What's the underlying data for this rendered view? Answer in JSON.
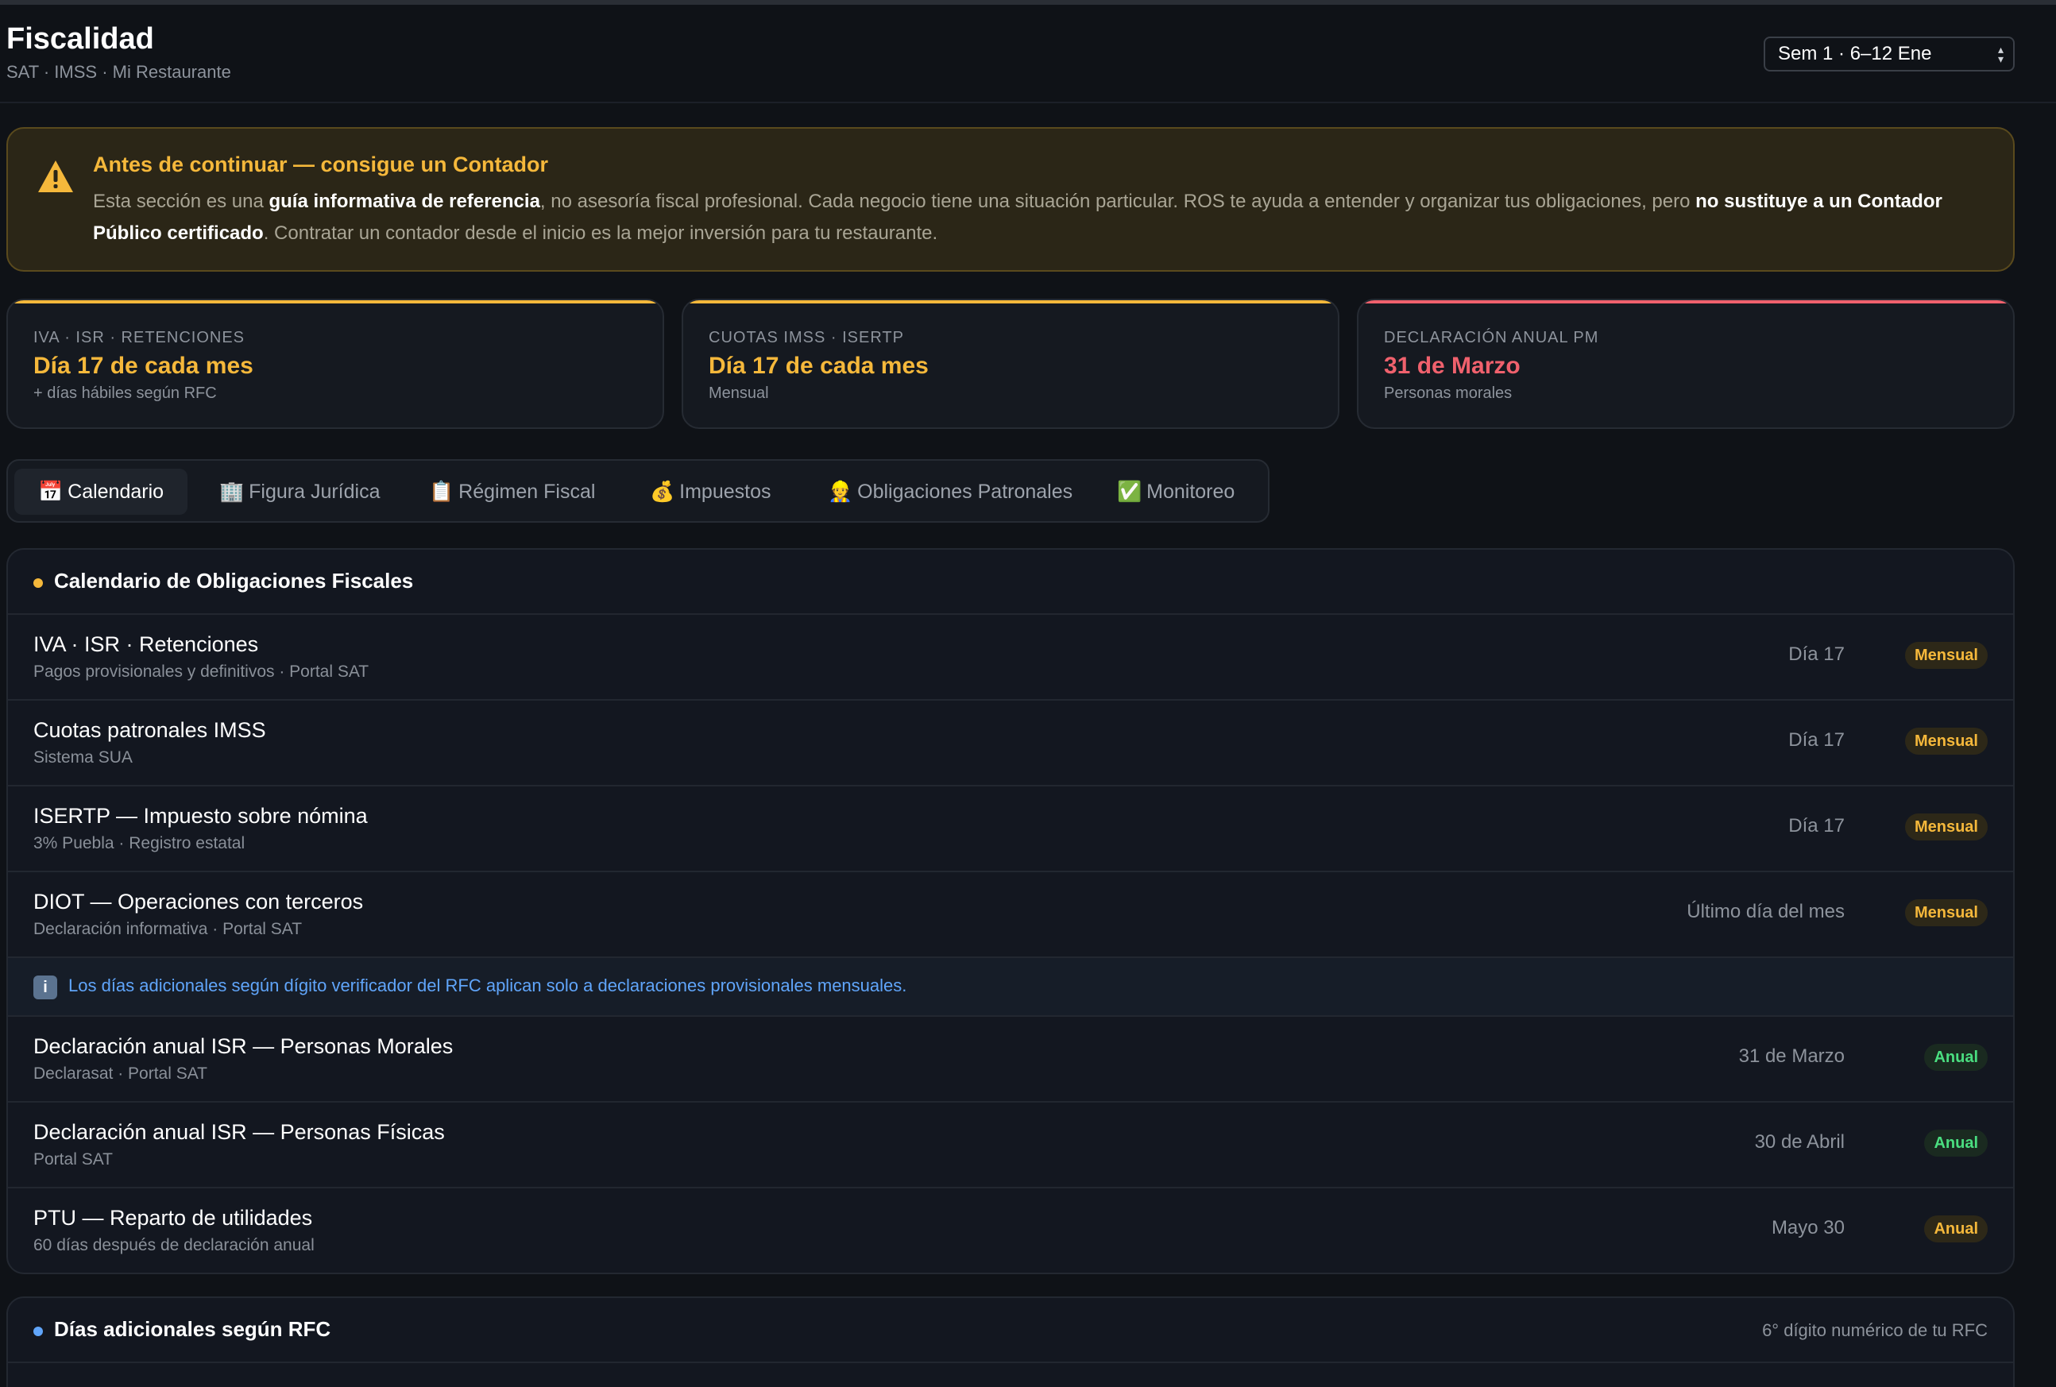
{
  "header": {
    "title": "Fiscalidad",
    "subtitle": "SAT · IMSS · Mi Restaurante",
    "week_selector": "Sem 1 · 6–12 Ene"
  },
  "warning": {
    "icon": "warning-triangle-icon",
    "title": "Antes de continuar — consigue un Contador",
    "text_1": "Esta sección es una ",
    "bold_1": "guía informativa de referencia",
    "text_2": ", no asesoría fiscal profesional. Cada negocio tiene una situación particular. ROS te ayuda a entender y organizar tus obligaciones, pero ",
    "bold_2": "no sustituye a un Contador Público certificado",
    "text_3": ". Contratar un contador desde el inicio es la mejor inversión para tu restaurante."
  },
  "cards": [
    {
      "label": "IVA · ISR · RETENCIONES",
      "value": "Día 17 de cada mes",
      "note": "+ días hábiles según RFC",
      "accent": "#f5b83b"
    },
    {
      "label": "CUOTAS IMSS · ISERTP",
      "value": "Día 17 de cada mes",
      "note": "Mensual",
      "accent": "#f5b83b"
    },
    {
      "label": "DECLARACIÓN ANUAL PM",
      "value": "31 de Marzo",
      "note": "Personas morales",
      "accent": "#f0616d"
    }
  ],
  "tabs": [
    {
      "icon": "📅",
      "label": "Calendario"
    },
    {
      "icon": "🏢",
      "label": "Figura Jurídica"
    },
    {
      "icon": "📋",
      "label": "Régimen Fiscal"
    },
    {
      "icon": "💰",
      "label": "Impuestos"
    },
    {
      "icon": "👷",
      "label": "Obligaciones Patronales"
    },
    {
      "icon": "✅",
      "label": "Monitoreo"
    }
  ],
  "calendar": {
    "title": "Calendario de Obligaciones Fiscales",
    "dot_color": "#f5b83b",
    "rows": [
      {
        "name": "IVA · ISR · Retenciones",
        "desc": "Pagos provisionales y definitivos · Portal SAT",
        "when": "Día 17",
        "badge": "Mensual"
      },
      {
        "name": "Cuotas patronales IMSS",
        "desc": "Sistema SUA",
        "when": "Día 17",
        "badge": "Mensual"
      },
      {
        "name": "ISERTP — Impuesto sobre nómina",
        "desc": "3% Puebla · Registro estatal",
        "when": "Día 17",
        "badge": "Mensual"
      },
      {
        "name": "DIOT — Operaciones con terceros",
        "desc": "Declaración informativa · Portal SAT",
        "when": "Último día del mes",
        "badge": "Mensual"
      }
    ],
    "info": {
      "icon": "i",
      "text": "Los días adicionales según dígito verificador del RFC aplican solo a declaraciones provisionales mensuales."
    },
    "annual_rows": [
      {
        "name": "Declaración anual ISR — Personas Morales",
        "desc": "Declarasat · Portal SAT",
        "when": "31 de Marzo",
        "badge": "Anual"
      },
      {
        "name": "Declaración anual ISR — Personas Físicas",
        "desc": "Portal SAT",
        "when": "30 de Abril",
        "badge": "Anual"
      },
      {
        "name": "PTU — Reparto de utilidades",
        "desc": "60 días después de declaración anual",
        "when": "Mayo 30",
        "badge": "Anual"
      }
    ]
  },
  "rfc_panel": {
    "title": "Días adicionales según RFC",
    "hint": "6° dígito numérico de tu RFC",
    "dot_color": "#60a5fa"
  }
}
